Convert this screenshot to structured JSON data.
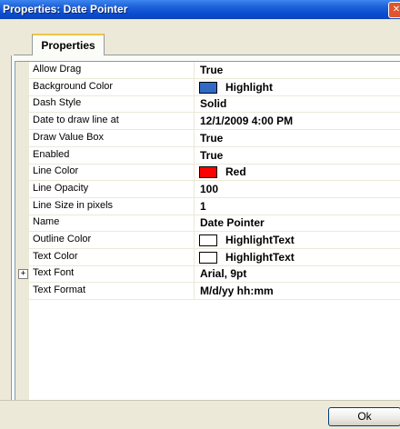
{
  "window": {
    "title": "Properties: Date Pointer",
    "close_glyph": "✕"
  },
  "tabs": [
    {
      "label": "Properties",
      "active": true
    }
  ],
  "properties": [
    {
      "name": "Allow Drag",
      "value": "True"
    },
    {
      "name": "Background Color",
      "value": "Highlight",
      "swatch": "#316ac5"
    },
    {
      "name": "Dash Style",
      "value": "Solid"
    },
    {
      "name": "Date to draw line at",
      "value": "12/1/2009 4:00 PM"
    },
    {
      "name": "Draw Value Box",
      "value": "True"
    },
    {
      "name": "Enabled",
      "value": "True"
    },
    {
      "name": "Line Color",
      "value": "Red",
      "swatch": "#ff0000"
    },
    {
      "name": "Line Opacity",
      "value": "100"
    },
    {
      "name": "Line Size in pixels",
      "value": "1"
    },
    {
      "name": "Name",
      "value": "Date Pointer"
    },
    {
      "name": "Outline Color",
      "value": "HighlightText",
      "swatch": "#ffffff"
    },
    {
      "name": "Text Color",
      "value": "HighlightText",
      "swatch": "#ffffff"
    },
    {
      "name": "Text Font",
      "value": "Arial, 9pt",
      "expandable": true,
      "expander_glyph": "+"
    },
    {
      "name": "Text Format",
      "value": "M/d/yy hh:mm"
    }
  ],
  "buttons": {
    "ok_label": "Ok"
  }
}
